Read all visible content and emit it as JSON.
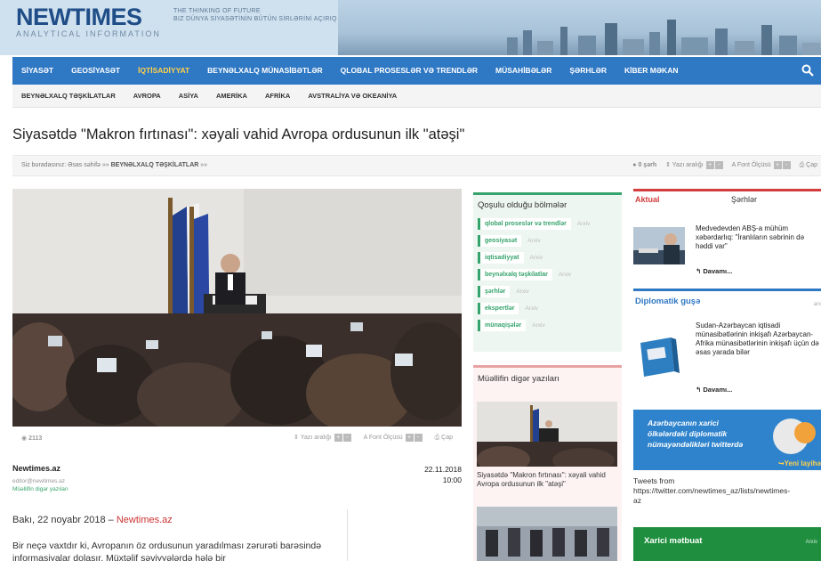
{
  "header": {
    "logo_new": "NEW",
    "logo_times": "TIMES",
    "logo_sub": "ANALYTICAL INFORMATION",
    "tagline_1": "THE THINKING OF FUTURE",
    "tagline_2": "BIZ DÜNYA SİYASƏTİNİN BÜTÜN SİRLƏRİNİ AÇIRIQ"
  },
  "main_nav": [
    {
      "label": "SİYASƏT"
    },
    {
      "label": "GEOSİYASƏT"
    },
    {
      "label": "İQTİSADİYYAT"
    },
    {
      "label": "BEYNƏLXALQ MÜNASİBƏTLƏR"
    },
    {
      "label": "QLOBAL PROSESLƏR VƏ TRENDLƏR"
    },
    {
      "label": "MÜSAHİBƏLƏR"
    },
    {
      "label": "ŞƏRHLƏR"
    },
    {
      "label": "KİBER MƏKAN"
    }
  ],
  "sub_nav": [
    {
      "label": "BEYNƏLXALQ TƏŞKİLATLAR"
    },
    {
      "label": "AVROPA"
    },
    {
      "label": "ASİYA"
    },
    {
      "label": "AMERİKA"
    },
    {
      "label": "AFRİKA"
    },
    {
      "label": "AVSTRALİYA VƏ OKEANİYA"
    }
  ],
  "article": {
    "title": "Siyasətdə \"Makron fırtınası\": xəyali vahid Avropa ordusunun ilk \"atəşi\"",
    "breadcrumb_prefix": "Siz buradasınız: Əsas səhifə »»",
    "breadcrumb_section": "BEYNƏLXALQ TƏŞKİLATLAR",
    "breadcrumb_suffix": "»»",
    "comments": "0 şərh",
    "font_size_label": "Yazı aralığı",
    "font_label": "Font Ölçüsü",
    "print_label": "Çap",
    "views": "2113",
    "author": "Newtimes.az",
    "author_email": "editor@newtimes.az",
    "author_link": "Müəllifin digər yazıları",
    "date": "22.11.2018",
    "time": "10:00",
    "lead_prefix": "Bakı, 22 noyabr 2018 –",
    "lead_link": "Newtimes.az",
    "body": "Bir neçə vaxtdır ki, Avropanın öz ordusunun yaradılması zərurəti barəsində informasiyalar dolaşır. Müxtəlif səviyyələrdə hələ bir"
  },
  "sections_box": {
    "title": "Qoşulu olduğu bölmələr",
    "archive": "Arxiv",
    "tags": [
      {
        "label": "qlobal proseslər və trendlər"
      },
      {
        "label": "geosiyasət"
      },
      {
        "label": "iqtisadiyyat"
      },
      {
        "label": "beynəlxalq təşkilatlar"
      },
      {
        "label": "şərhlər"
      },
      {
        "label": "ekspertlər"
      },
      {
        "label": "münaqişələr"
      }
    ]
  },
  "author_box": {
    "title": "Müəllifin digər yazıları",
    "caption": "Siyasətdə \"Makron fırtınası\": xəyali vahid Avropa ordusunun ilk \"atəşi\""
  },
  "aktual": {
    "tab1": "Aktual",
    "tab2": "Şərhlər",
    "news": "Medvedevden ABŞ-a mühüm xəbərdarlıq: \"İranlıların səbrinin də həddi var\"",
    "more": "Davamı..."
  },
  "diplomatic": {
    "title": "Diplomatik guşə",
    "archive": "arx",
    "text": "Sudan-Azərbaycan iqtisadi münasibətlərinin inkişafı Azərbaycan-Afrika münasibətlərinin inkişafı üçün də əsas yarada bilər",
    "more": "Davamı..."
  },
  "twitter_banner": {
    "line1": "Azərbaycanın xarici",
    "line2": "ölkələrdəki diplomatik",
    "line3": "nümayəndəlikləri twitterdə",
    "new_label": "↪Yeni layihə"
  },
  "tweets": {
    "line1": "Tweets from",
    "line2": "https://twitter.com/newtimes_az/lists/newtimes-",
    "line3": "az"
  },
  "xarici": {
    "title": "Xarici mətbuat",
    "archive": "Arxiv"
  },
  "colors": {
    "nav_blue": "#2f78c4",
    "accent_red": "#d33d3d",
    "green": "#35a46c"
  }
}
